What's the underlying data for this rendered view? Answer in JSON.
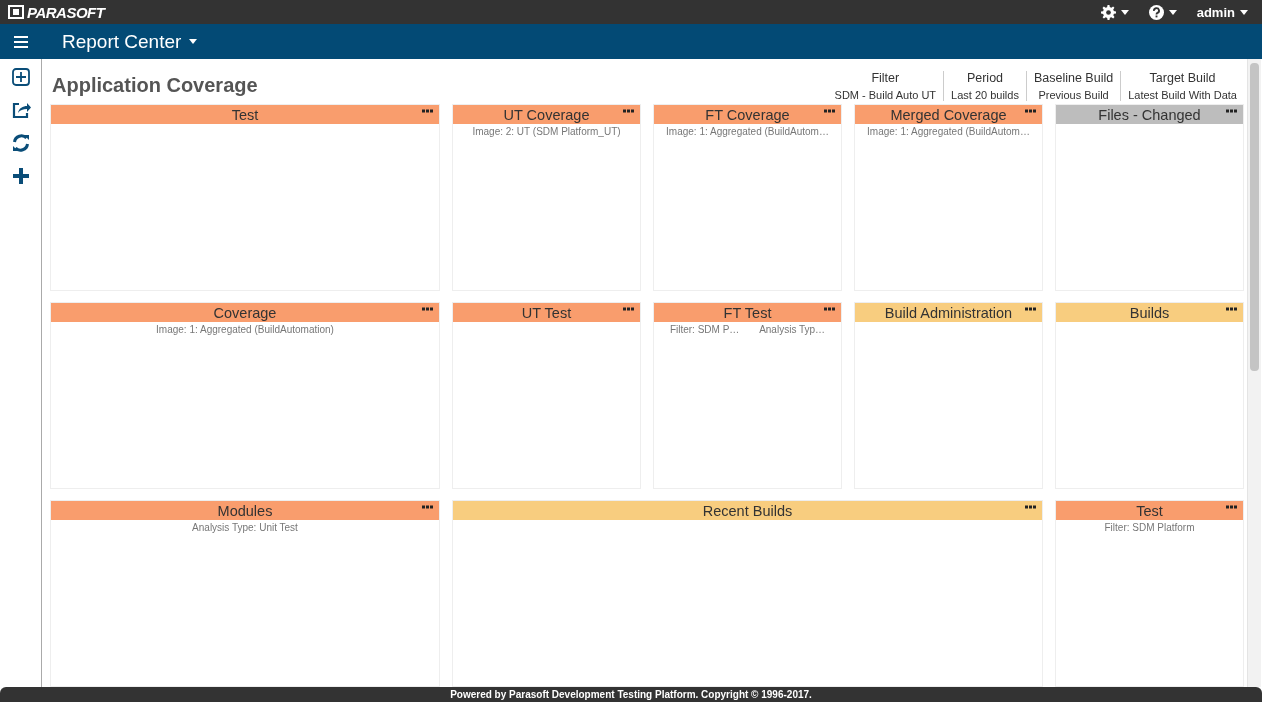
{
  "top_bar": {
    "logo": "PARASOFT",
    "user": "admin"
  },
  "nav_bar": {
    "title": "Report Center"
  },
  "page": {
    "title": "Application Coverage"
  },
  "settings": [
    {
      "label": "Filter",
      "value": "SDM - Build Auto UT"
    },
    {
      "label": "Period",
      "value": "Last 20 builds"
    },
    {
      "label": "Baseline Build",
      "value": "Previous Build"
    },
    {
      "label": "Target Build",
      "value": "Latest Build With Data"
    }
  ],
  "widgets": [
    {
      "title": "Test",
      "color": "#f99d6d"
    },
    {
      "title": "UT Coverage",
      "color": "#f99d6d",
      "subtitles": [
        "Image: 2: UT (SDM Platform_UT)"
      ]
    },
    {
      "title": "FT Coverage",
      "color": "#f99d6d",
      "subtitles": [
        "Image: 1: Aggregated (BuildAutom…"
      ]
    },
    {
      "title": "Merged Coverage",
      "color": "#f99d6d",
      "subtitles": [
        "Image: 1: Aggregated (BuildAutom…"
      ]
    },
    {
      "title": "Files - Changed",
      "color": "#bdbdbd"
    },
    {
      "title": "Coverage",
      "color": "#f99d6d",
      "subtitles": [
        "Image: 1: Aggregated (BuildAutomation)"
      ]
    },
    {
      "title": "UT Test",
      "color": "#f99d6d"
    },
    {
      "title": "FT Test",
      "color": "#f99d6d",
      "subtitles": [
        "Filter: SDM P…",
        "Analysis Typ…"
      ]
    },
    {
      "title": "Build Administration",
      "color": "#f8cd7f"
    },
    {
      "title": "Builds",
      "color": "#f8cd7f"
    },
    {
      "title": "Modules",
      "color": "#f99d6d",
      "subtitles": [
        "Analysis Type: Unit Test"
      ]
    },
    {
      "title": "Recent Builds",
      "color": "#f8cd7f"
    },
    {
      "title": "Test",
      "color": "#f99d6d",
      "subtitles": [
        "Filter: SDM Platform"
      ]
    }
  ],
  "footer": {
    "text": "Powered by Parasoft Development Testing Platform. Copyright © 1996-2017."
  }
}
